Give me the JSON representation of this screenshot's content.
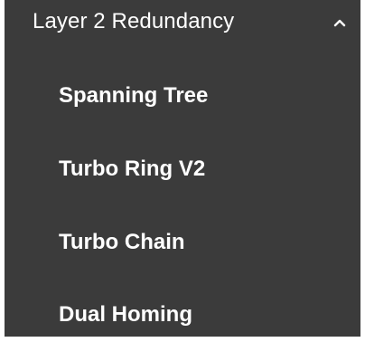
{
  "menu": {
    "section_label": "Layer 2 Redundancy",
    "expanded_icon": "chevron-up-icon",
    "items": [
      {
        "label": "Spanning Tree"
      },
      {
        "label": "Turbo Ring V2"
      },
      {
        "label": "Turbo Chain"
      },
      {
        "label": "Dual Homing"
      }
    ]
  },
  "colors": {
    "background": "#3b3b3b",
    "text": "#ffffff"
  }
}
